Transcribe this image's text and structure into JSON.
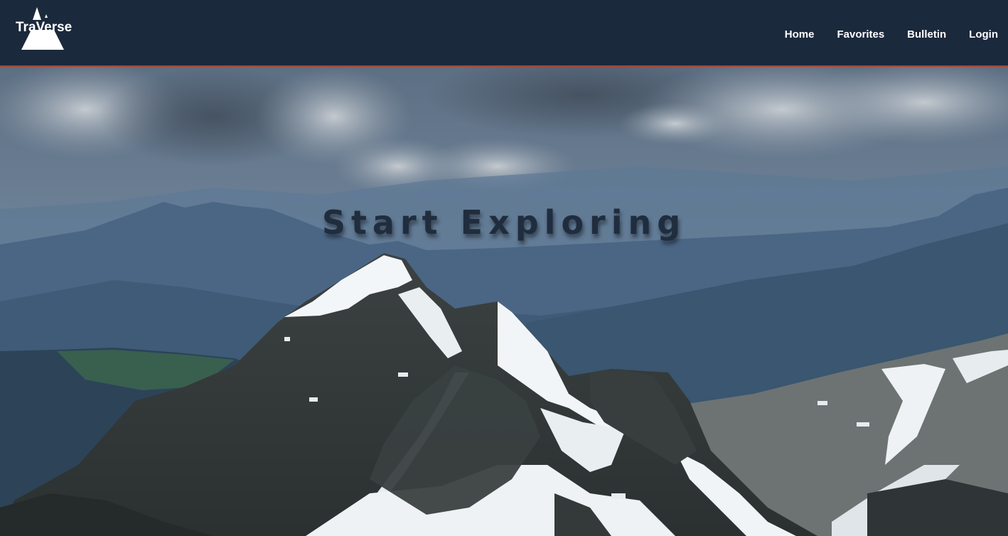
{
  "brand": {
    "name": "TraVerse",
    "icon": "mountain-logo-icon"
  },
  "nav": {
    "items": [
      {
        "label": "Home"
      },
      {
        "label": "Favorites"
      },
      {
        "label": "Bulletin"
      },
      {
        "label": "Login"
      }
    ]
  },
  "hero": {
    "title": "Start Exploring",
    "image": "snowy-mountain-peak-image"
  },
  "colors": {
    "navbar_bg": "#1b293c",
    "navbar_border": "#b0402a",
    "title_text": "#1f2d3e"
  }
}
